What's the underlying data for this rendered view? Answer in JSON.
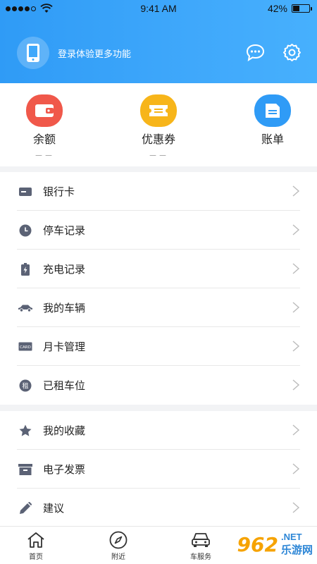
{
  "status_bar": {
    "time": "9:41 AM",
    "battery": "42%",
    "battery_level": 0.42
  },
  "header": {
    "login_prompt": "登录体验更多功能"
  },
  "quick_actions": [
    {
      "label": "余额",
      "sub": "－－",
      "color": "#f0584a"
    },
    {
      "label": "优惠券",
      "sub": "－－",
      "color": "#f7b51a"
    },
    {
      "label": "账单",
      "sub": "",
      "color": "#2f9bf6"
    }
  ],
  "menu_group_1": [
    {
      "label": "银行卡",
      "icon": "bank-card-icon"
    },
    {
      "label": "停车记录",
      "icon": "clock-icon"
    },
    {
      "label": "充电记录",
      "icon": "battery-charge-icon"
    },
    {
      "label": "我的车辆",
      "icon": "car-icon"
    },
    {
      "label": "月卡管理",
      "icon": "card-icon",
      "icon_text": "CARD"
    },
    {
      "label": "已租车位",
      "icon": "rent-icon",
      "icon_text": "租"
    }
  ],
  "menu_group_2": [
    {
      "label": "我的收藏",
      "icon": "star-icon"
    },
    {
      "label": "电子发票",
      "icon": "invoice-icon"
    },
    {
      "label": "建议",
      "icon": "pencil-icon"
    }
  ],
  "tabbar": [
    {
      "label": "首页",
      "icon": "home-icon"
    },
    {
      "label": "附近",
      "icon": "compass-icon"
    },
    {
      "label": "车服务",
      "icon": "car-service-icon"
    }
  ],
  "watermark": {
    "badge": "962",
    "net": ".NET",
    "cn": "乐游网"
  },
  "colors": {
    "accent": "#2f9bf6",
    "icon_gray": "#5b6275"
  }
}
